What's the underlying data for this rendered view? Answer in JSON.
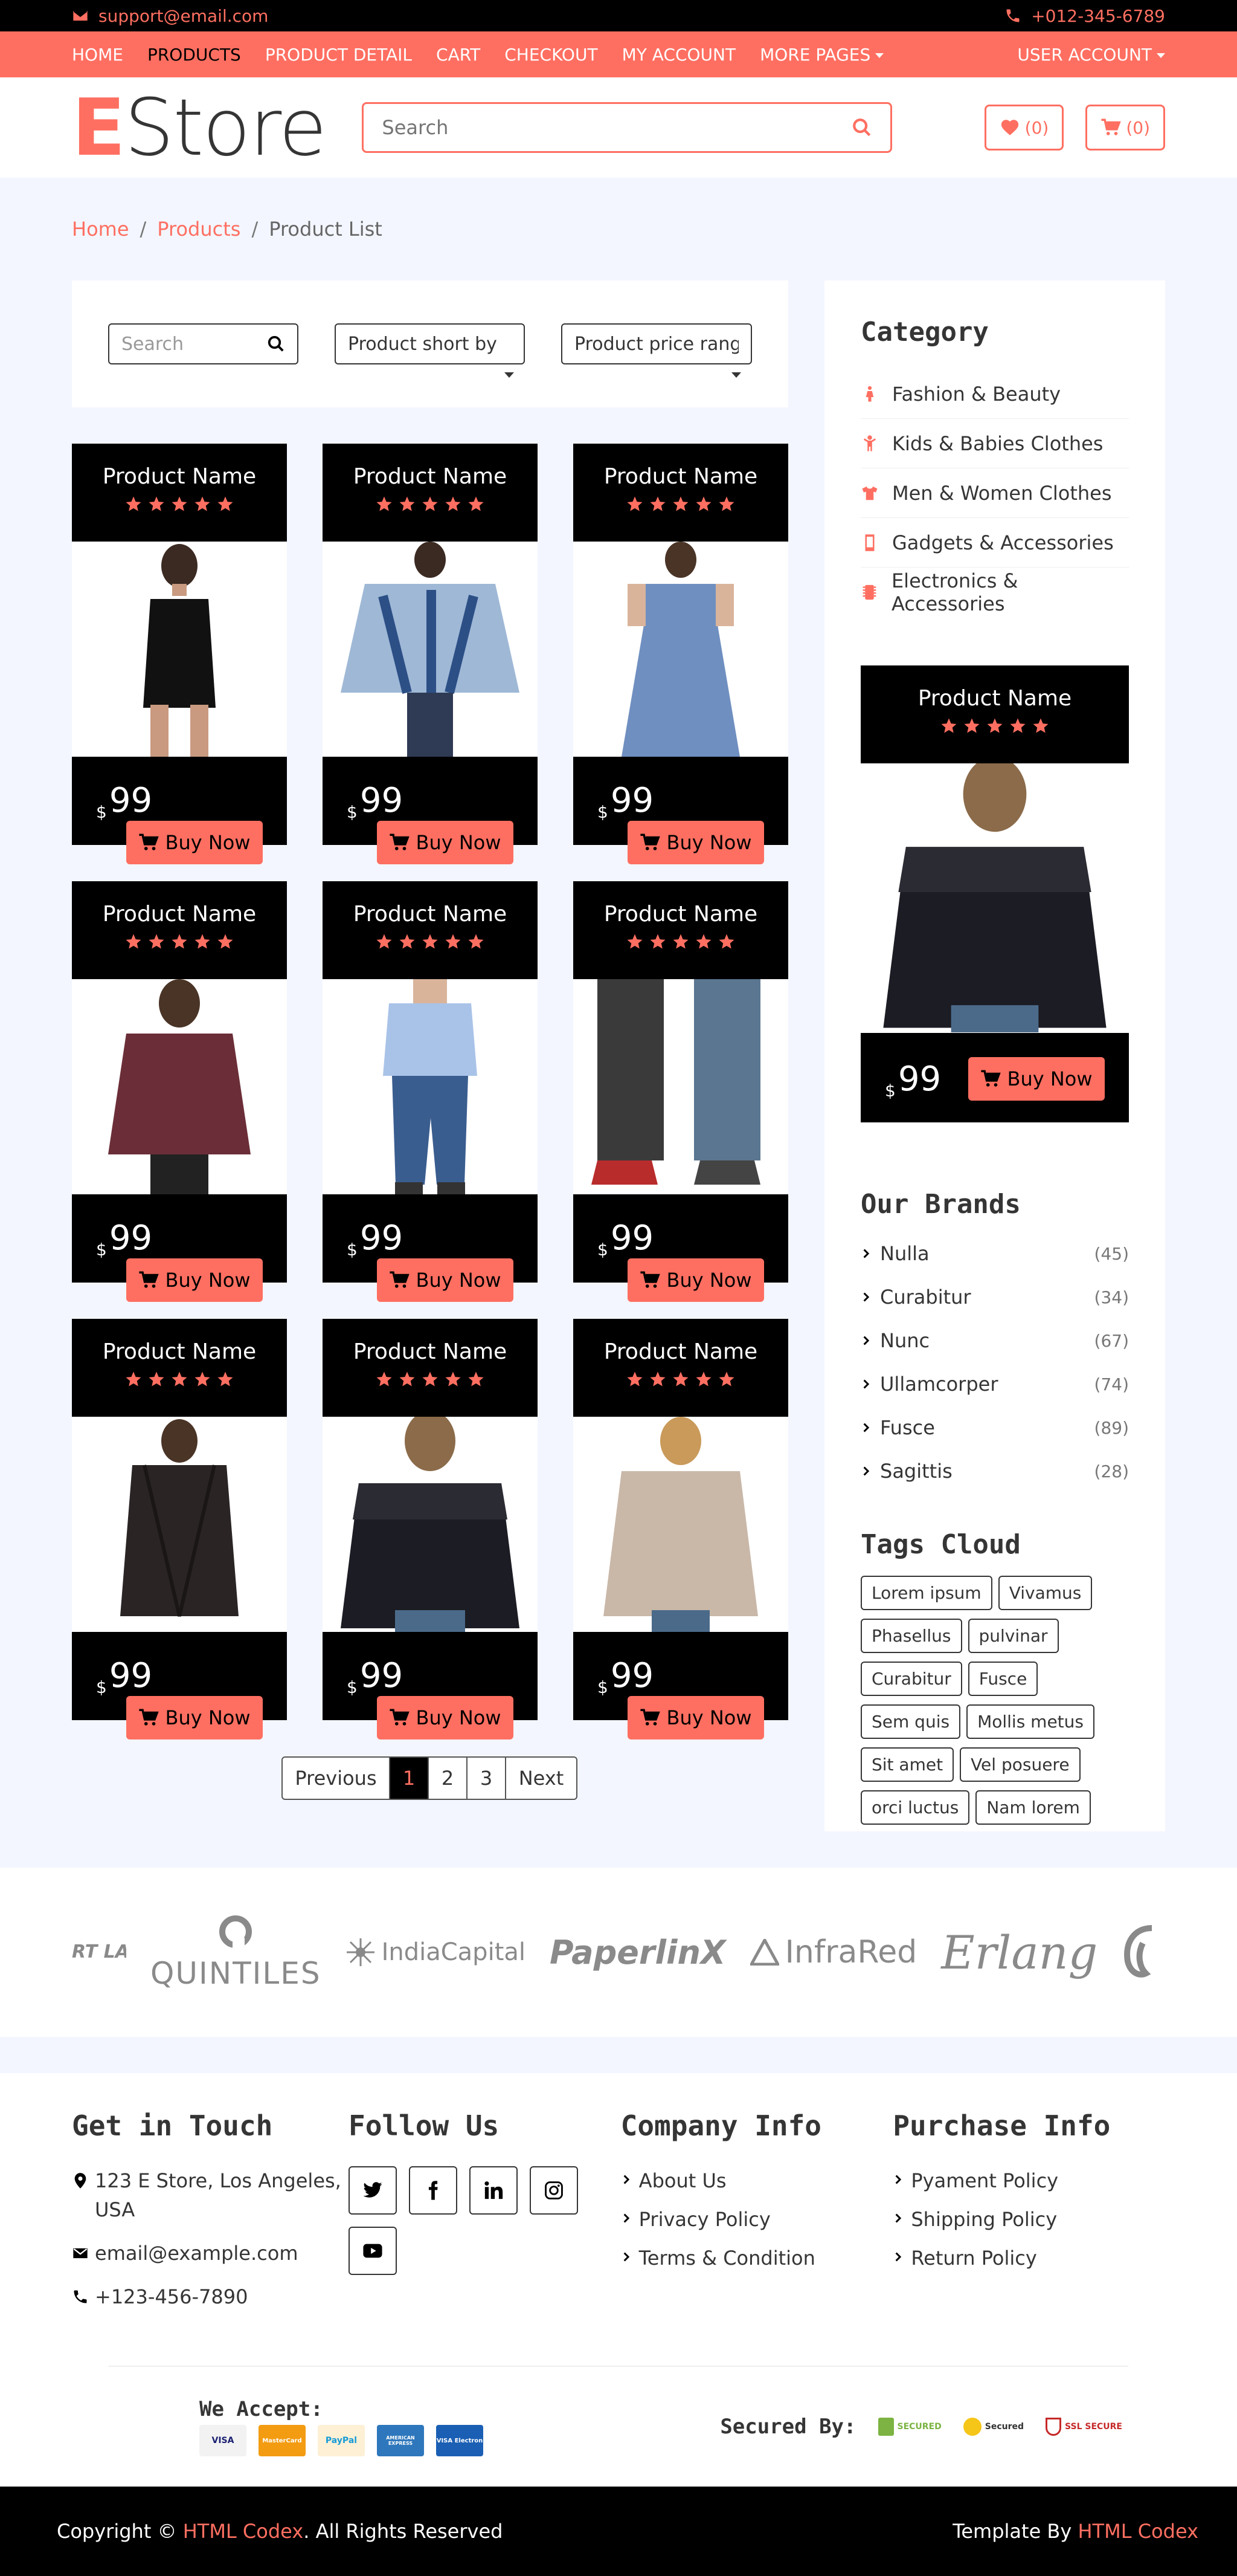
{
  "topbar": {
    "email": "support@email.com",
    "phone": "+012-345-6789"
  },
  "nav": {
    "items": [
      "HOME",
      "PRODUCTS",
      "PRODUCT DETAIL",
      "CART",
      "CHECKOUT",
      "MY ACCOUNT",
      "MORE PAGES"
    ],
    "user_account": "USER ACCOUNT"
  },
  "header": {
    "logo_first": "E",
    "logo_rest": "Store",
    "search_placeholder": "Search",
    "wishlist_count": "(0)",
    "cart_count": "(0)"
  },
  "breadcrumb": {
    "home": "Home",
    "products": "Products",
    "current": "Product List"
  },
  "filter": {
    "search_placeholder": "Search",
    "sort_label": "Product short by",
    "price_label": "Product price range"
  },
  "products": [
    {
      "name": "Product Name",
      "currency": "$",
      "price": "99",
      "buy": "Buy Now",
      "image": "woman-black-dress"
    },
    {
      "name": "Product Name",
      "currency": "$",
      "price": "99",
      "buy": "Buy Now",
      "image": "woman-tie-dye-top"
    },
    {
      "name": "Product Name",
      "currency": "$",
      "price": "99",
      "buy": "Buy Now",
      "image": "woman-blue-dress"
    },
    {
      "name": "Product Name",
      "currency": "$",
      "price": "99",
      "buy": "Buy Now",
      "image": "woman-maroon-top"
    },
    {
      "name": "Product Name",
      "currency": "$",
      "price": "99",
      "buy": "Buy Now",
      "image": "boy-denim"
    },
    {
      "name": "Product Name",
      "currency": "$",
      "price": "99",
      "buy": "Buy Now",
      "image": "couple-jeans"
    },
    {
      "name": "Product Name",
      "currency": "$",
      "price": "99",
      "buy": "Buy Now",
      "image": "woman-dark-cardigan"
    },
    {
      "name": "Product Name",
      "currency": "$",
      "price": "99",
      "buy": "Buy Now",
      "image": "woman-black-lace-blouse"
    },
    {
      "name": "Product Name",
      "currency": "$",
      "price": "99",
      "buy": "Buy Now",
      "image": "woman-beige-sweater"
    }
  ],
  "rating": 5,
  "pagination": {
    "previous": "Previous",
    "pages": [
      "1",
      "2",
      "3"
    ],
    "active": "1",
    "next": "Next"
  },
  "sidebar": {
    "category_title": "Category",
    "categories": [
      {
        "label": "Fashion & Beauty",
        "icon": "female-icon"
      },
      {
        "label": "Kids & Babies Clothes",
        "icon": "child-icon"
      },
      {
        "label": "Men & Women Clothes",
        "icon": "tshirt-icon"
      },
      {
        "label": "Gadgets & Accessories",
        "icon": "mobile-icon"
      },
      {
        "label": "Electronics & Accessories",
        "icon": "microchip-icon"
      }
    ],
    "featured": {
      "name": "Product Name",
      "currency": "$",
      "price": "99",
      "buy": "Buy Now",
      "image": "woman-black-lace-blouse"
    },
    "brands_title": "Our Brands",
    "brands": [
      {
        "name": "Nulla",
        "count": "(45)"
      },
      {
        "name": "Curabitur",
        "count": "(34)"
      },
      {
        "name": "Nunc",
        "count": "(67)"
      },
      {
        "name": "Ullamcorper",
        "count": "(74)"
      },
      {
        "name": "Fusce",
        "count": "(89)"
      },
      {
        "name": "Sagittis",
        "count": "(28)"
      }
    ],
    "tags_title": "Tags Cloud",
    "tags": [
      "Lorem ipsum",
      "Vivamus",
      "Phasellus",
      "pulvinar",
      "Curabitur",
      "Fusce",
      "Sem quis",
      "Mollis metus",
      "Sit amet",
      "Vel posuere",
      "orci luctus",
      "Nam lorem"
    ]
  },
  "brand_logos": [
    "RT LAND",
    "QUINTILES",
    "IndiaCapital",
    "PaperlinX",
    "InfraRed",
    "Erlang"
  ],
  "footer": {
    "touch_title": "Get in Touch",
    "address": "123 E Store, Los Angeles, USA",
    "email": "email@example.com",
    "phone": "+123-456-7890",
    "follow_title": "Follow Us",
    "socials": [
      "twitter-icon",
      "facebook-icon",
      "linkedin-icon",
      "instagram-icon",
      "youtube-icon"
    ],
    "company_title": "Company Info",
    "company_links": [
      "About Us",
      "Privacy Policy",
      "Terms & Condition"
    ],
    "purchase_title": "Purchase Info",
    "purchase_links": [
      "Pyament Policy",
      "Shipping Policy",
      "Return Policy"
    ],
    "accept_title": "We Accept:",
    "payment_cards": [
      "VISA",
      "MasterCard",
      "PayPal",
      "AMERICAN EXPRESS",
      "VISA Electron"
    ],
    "secured_title": "Secured By:",
    "secured_badges": [
      "SECURED",
      "Secured",
      "SSL SECURE"
    ]
  },
  "copyright": {
    "prefix": "Copyright ©",
    "brand": "HTML Codex",
    "suffix": ". All Rights Reserved",
    "template_prefix": "Template By",
    "template_brand": "HTML Codex"
  },
  "colors": {
    "accent": "#FF6F61",
    "dark": "#000000",
    "text": "#353535",
    "page_bg": "#f3f6ff"
  }
}
